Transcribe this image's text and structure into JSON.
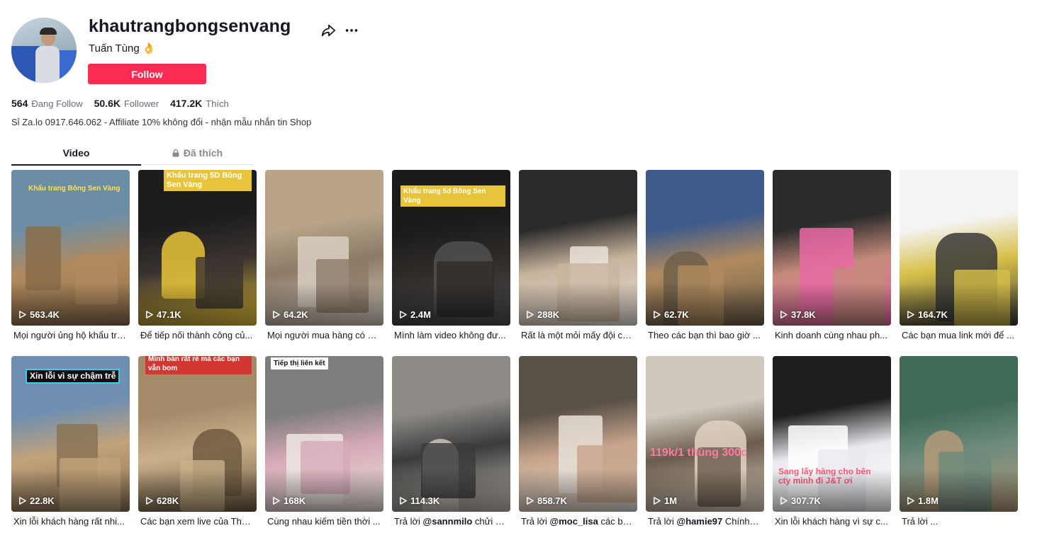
{
  "profile": {
    "username": "khautrangbongsenvang",
    "nickname": "Tuấn Tùng 👌",
    "follow_label": "Follow",
    "bio": "Sỉ Za.lo 0917.646.062 - Affiliate 10% không đổi - nhận mẫu nhắn tin Shop",
    "stats": [
      {
        "value": "564",
        "label": "Đang Follow"
      },
      {
        "value": "50.6K",
        "label": "Follower"
      },
      {
        "value": "417.2K",
        "label": "Thích"
      }
    ]
  },
  "tabs": {
    "video": "Video",
    "liked": "Đã thích"
  },
  "colors": {
    "accent": "#fe2c55",
    "text": "#161823",
    "muted": "#6b6d76"
  },
  "videos": [
    {
      "views": "563.4K",
      "caption": "Mọi người ủng hộ khẩu trang...",
      "overlay": "Khẩu trang Bông Sen Vàng"
    },
    {
      "views": "47.1K",
      "caption": "Để tiếp nối thành công củ...",
      "overlay": "Khẩu trang 5D Bông Sen Vàng"
    },
    {
      "views": "64.2K",
      "caption": "Mọi người mua hàng có sa...",
      "overlay": ""
    },
    {
      "views": "2.4M",
      "caption": "Mình làm video không đư...",
      "overlay": "Khẩu trang 5d Bông Sen Vàng"
    },
    {
      "views": "288K",
      "caption": "Rất là một mỏi mấy đội ch...",
      "overlay": ""
    },
    {
      "views": "62.7K",
      "caption": "Theo các bạn thì bao giờ ...",
      "overlay": ""
    },
    {
      "views": "37.8K",
      "caption": "Kinh doanh cùng nhau ph...",
      "overlay": ""
    },
    {
      "views": "164.7K",
      "caption": "Các bạn mua link mới để ...",
      "overlay": ""
    },
    {
      "views": "22.8K",
      "caption": "Xin lỗi khách hàng rất nhi...",
      "overlay": "Xin lỗi vì sự chậm trễ"
    },
    {
      "views": "628K",
      "caption": "Các bạn xem live của Tho...",
      "overlay": "Mình bán rất rẻ mà các bạn vẫn bom"
    },
    {
      "views": "168K",
      "caption": "Cùng nhau kiếm tiền thời ...",
      "overlay": "Tiếp thị liên kết"
    },
    {
      "views": "114.3K",
      "caption_prefix": "Trả lời ",
      "caption_handle": "@sannmilo",
      "caption": " chửi n...",
      "overlay": ""
    },
    {
      "views": "858.7K",
      "caption_prefix": "Trả lời ",
      "caption_handle": "@moc_lisa",
      "caption": " các bạ...",
      "overlay": ""
    },
    {
      "views": "1M",
      "caption_prefix": "Trả lời ",
      "caption_handle": "@hamie97",
      "caption": " Chính v...",
      "overlay": "119k/1 thùng 300c"
    },
    {
      "views": "307.7K",
      "caption": "Xin lỗi khách hàng vì sự c...",
      "overlay": "Sang lấy hàng cho bên cty mình đi J&T ơi"
    },
    {
      "views": "1.8M",
      "caption": "Trả lời ...",
      "overlay": ""
    }
  ]
}
